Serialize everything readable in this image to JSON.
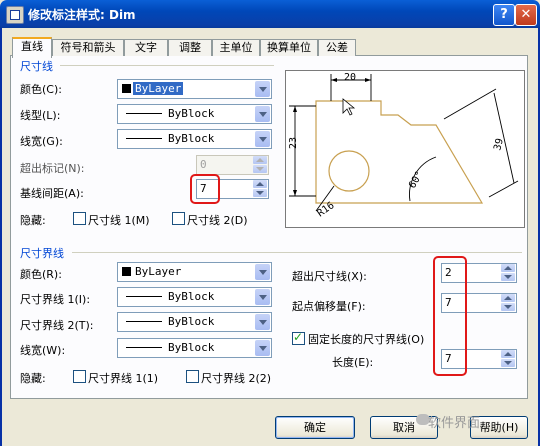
{
  "window": {
    "title": "修改标注样式: Dim",
    "help_glyph": "?",
    "close_glyph": "✕"
  },
  "tabs": [
    {
      "label": "直线",
      "active": true
    },
    {
      "label": "符号和箭头",
      "active": false
    },
    {
      "label": "文字",
      "active": false
    },
    {
      "label": "调整",
      "active": false
    },
    {
      "label": "主单位",
      "active": false
    },
    {
      "label": "换算单位",
      "active": false
    },
    {
      "label": "公差",
      "active": false
    }
  ],
  "dimension_lines": {
    "group_title": "尺寸线",
    "color_label": "颜色(C):",
    "color_value": "ByLayer",
    "linetype_label": "线型(L):",
    "linetype_value": "ByBlock",
    "lineweight_label": "线宽(G):",
    "lineweight_value": "ByBlock",
    "extend_ticks_label": "超出标记(N):",
    "extend_ticks_value": "0",
    "baseline_spacing_label": "基线间距(A):",
    "baseline_spacing_value": "7",
    "suppress_label": "隐藏:",
    "suppress_dim1_label": "尺寸线 1(M)",
    "suppress_dim2_label": "尺寸线 2(D)"
  },
  "extension_lines": {
    "group_title": "尺寸界线",
    "color_label": "颜色(R):",
    "color_value": "ByLayer",
    "ext1_linetype_label": "尺寸界线 1(I):",
    "ext1_linetype_value": "ByBlock",
    "ext2_linetype_label": "尺寸界线 2(T):",
    "ext2_linetype_value": "ByBlock",
    "lineweight_label": "线宽(W):",
    "lineweight_value": "ByBlock",
    "suppress_label": "隐藏:",
    "suppress_ext1_label": "尺寸界线 1(1)",
    "suppress_ext2_label": "尺寸界线 2(2)",
    "extend_beyond_label": "超出尺寸线(X):",
    "extend_beyond_value": "2",
    "offset_label": "起点偏移量(F):",
    "offset_value": "7",
    "fixed_length_label": "固定长度的尺寸界线(O)",
    "fixed_length_checked": true,
    "length_label": "长度(E):",
    "length_value": "7"
  },
  "preview": {
    "dim_top": "20",
    "dim_left": "23",
    "dim_right": "39",
    "dim_angle": "60°",
    "dim_radius": "R16"
  },
  "buttons": {
    "ok": "确定",
    "cancel": "取消",
    "help": "帮助(H)"
  },
  "watermark": "软件界面",
  "colors": {
    "title_bar": "#0a4fc4",
    "group_title": "#0046d5",
    "highlight": "#e01818",
    "preview_shape": "#c8a050"
  }
}
